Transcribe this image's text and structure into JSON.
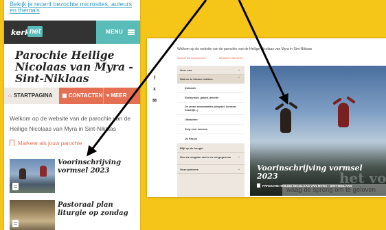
{
  "mobile": {
    "notice_link": "Bekijk je recent bezochte microsites, auteurs en thema's",
    "logo_text_1": "kerk",
    "logo_text_2": "net",
    "menu_label": "MENU",
    "title": "Parochie Heilige Nicolaas van Myra - Sint-Niklaas",
    "nav": {
      "home": "STARTPAGINA",
      "contact": "CONTACTEN",
      "more": "MEER"
    },
    "welcome": "Welkom op de website van de parochie van de Heilige Nicolaas van Myra in Sint-Niklaas",
    "mark_label": "Markeer als jouw parochie",
    "posts": [
      {
        "title": "Voorinschrijving vormsel 2023"
      },
      {
        "title": "Pastoraal plan liturgie op zondag"
      }
    ]
  },
  "desktop": {
    "welcome": "Welkom op de website van de parochie van de Heilige Nicolaas van Myra in Sint-Niklaas",
    "actions": {
      "mark": "Markeer als jouw parochie",
      "favorite": "Bewaard in favorieten"
    },
    "menu": {
      "over_ons": "Over ons",
      "wat_we_te_bieden_hebben": "Wat we te bieden hebben",
      "sub": [
        "Kalender",
        "Eucharistie, gebed, devotie",
        "De zeven sacramenten (doopsel, vormsel, huwelijk...)",
        "Uitvaarten",
        "Zorg voor mensen",
        "De Passie"
      ],
      "blijf_op_de_hoogte": "Blijf op de hoogte",
      "hoe_we_omgaan": "Hoe we omgaan met u en uw gegevens",
      "onze_partners": "Onze partners"
    },
    "hero": {
      "title": "Voorinschrijving vormsel 2023",
      "source": "PAROCHIE HEILIGE NICOLAAS VAN MYRA - SINT-NIKLAAS",
      "watermark": "het vormsel",
      "slogan": "waag de sprong om te geloven"
    }
  },
  "colors": {
    "background": "#f5c518",
    "accent_orange": "#e46f52",
    "accent_teal": "#5abcb9",
    "topbar_dark": "#333333",
    "menu_beige": "#eee7df"
  }
}
